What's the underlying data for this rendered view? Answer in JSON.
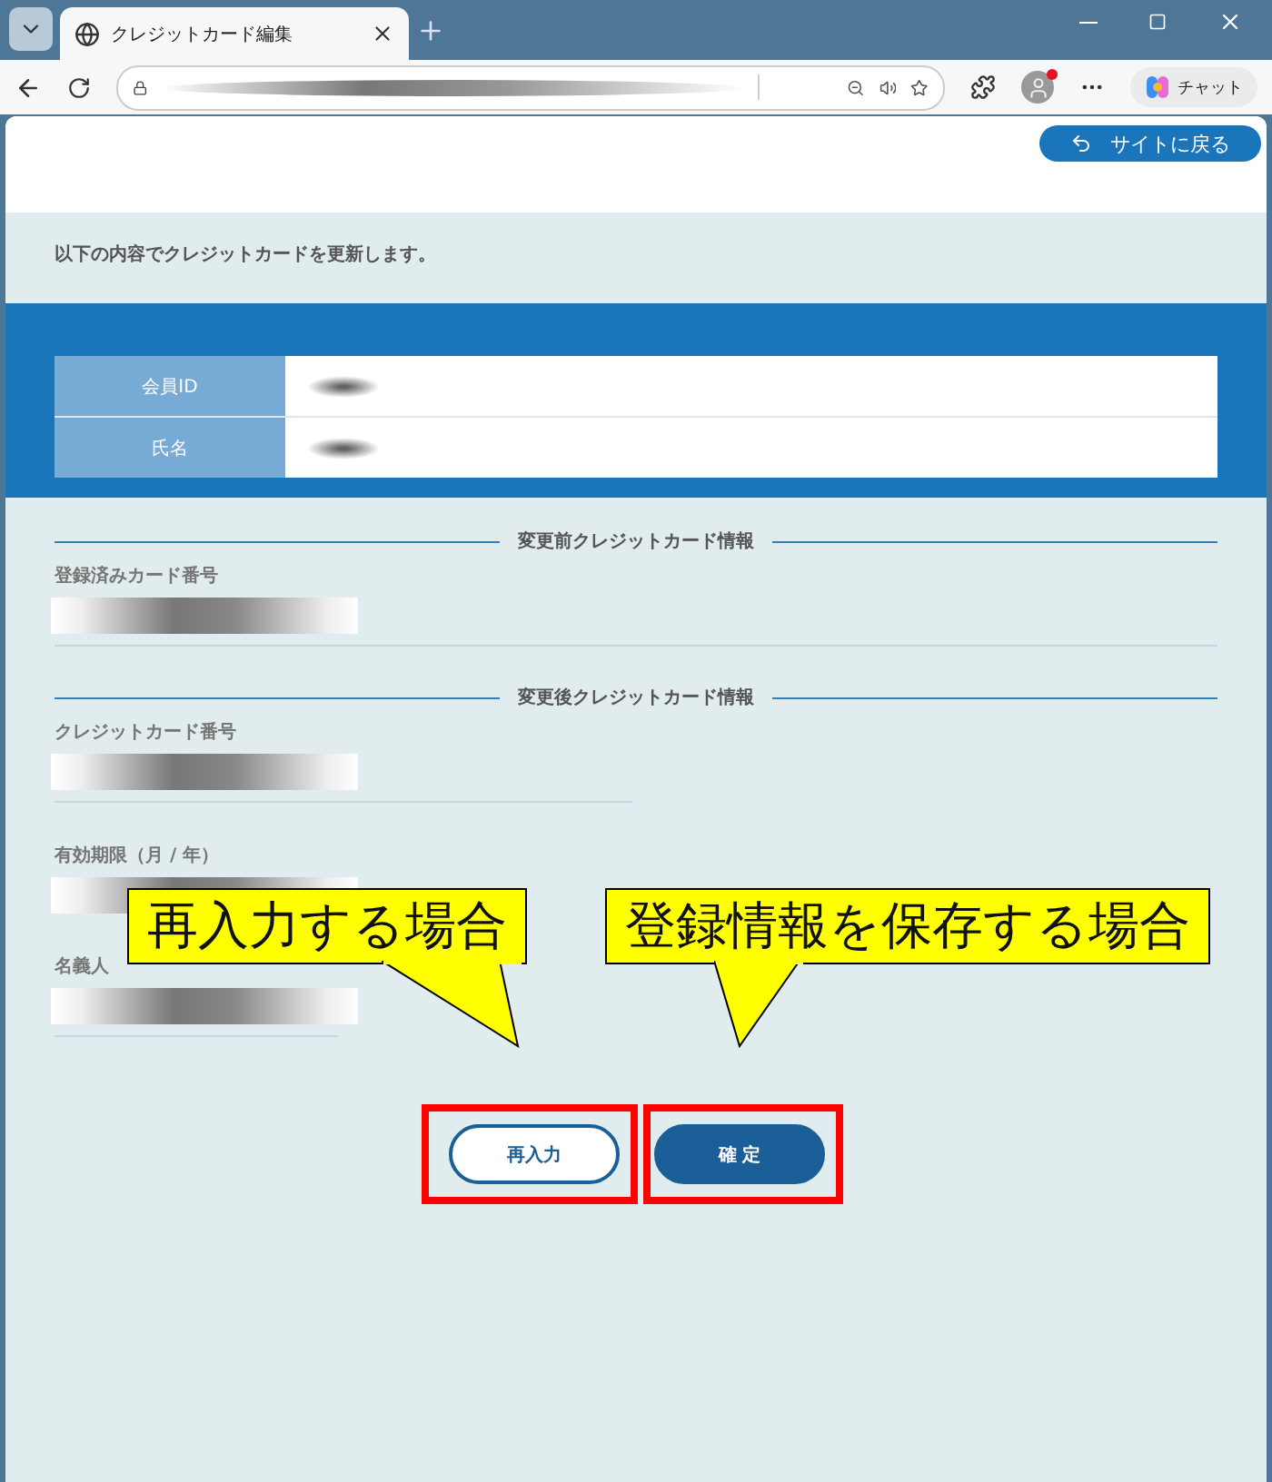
{
  "browser": {
    "tab_title": "クレジットカード編集",
    "chat_label": "チャット"
  },
  "page": {
    "back_button": "サイトに戻る",
    "intro": "以下の内容でクレジットカードを更新します。",
    "member_table": [
      {
        "label": "会員ID"
      },
      {
        "label": "氏名"
      }
    ],
    "sections": [
      {
        "heading": "変更前クレジットカード情報",
        "fields": [
          {
            "label": "登録済みカード番号"
          }
        ]
      },
      {
        "heading": "変更後クレジットカード情報",
        "fields": [
          {
            "label": "クレジットカード番号"
          },
          {
            "label": "有効期限（月 / 年）"
          },
          {
            "label": "名義人"
          }
        ]
      }
    ],
    "buttons": [
      {
        "label": "再入力",
        "kind": "outline",
        "highlighted": true
      },
      {
        "label": "確 定",
        "kind": "filled",
        "highlighted": true
      }
    ]
  },
  "callouts": [
    {
      "text": "再入力する場合"
    },
    {
      "text": "登録情報を保存する場合"
    }
  ]
}
